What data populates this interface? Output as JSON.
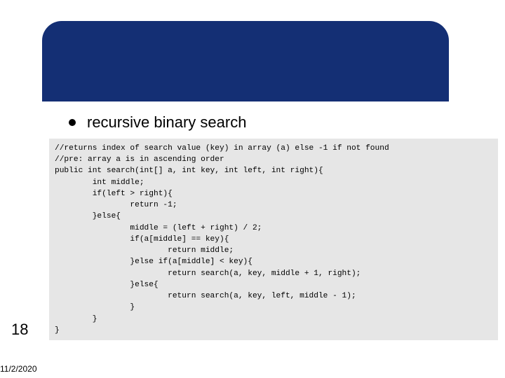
{
  "bullet_label": "recursive binary search",
  "page_number": "18",
  "date": "11/2/2020",
  "code": {
    "l1": "//returns index of search value (key) in array (a) else -1 if not found",
    "l2": "//pre: array a is in ascending order",
    "l3": "public int search(int[] a, int key, int left, int right){",
    "l4": "        int middle;",
    "l5": "        if(left > right){",
    "l6": "                return -1;",
    "l7": "        }else{",
    "l8": "                middle = (left + right) / 2;",
    "l9": "                if(a[middle] == key){",
    "l10": "                        return middle;",
    "l11": "                }else if(a[middle] < key){",
    "l12": "                        return search(a, key, middle + 1, right);",
    "l13": "                }else{",
    "l14": "                        return search(a, key, left, middle - 1);",
    "l15": "                }",
    "l16": "        }",
    "l17": "}"
  }
}
